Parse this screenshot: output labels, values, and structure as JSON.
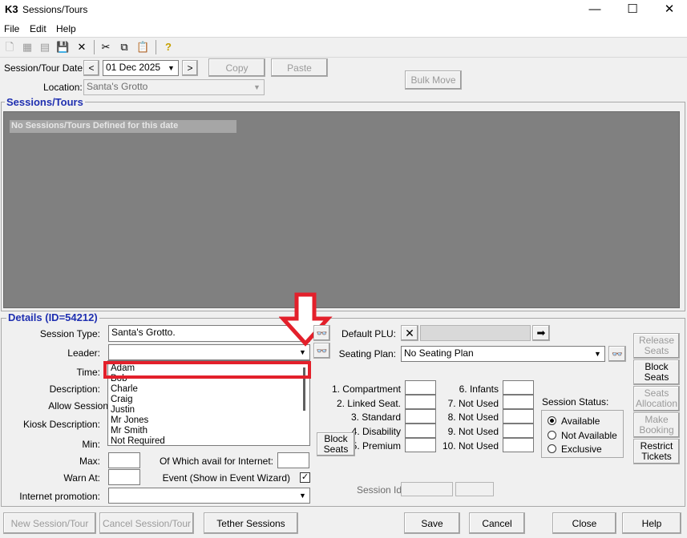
{
  "window": {
    "logo": "K3",
    "title": "Sessions/Tours",
    "minimize": "—",
    "maximize": "☐",
    "close": "✕"
  },
  "menu": {
    "file": "File",
    "edit": "Edit",
    "help": "Help"
  },
  "toolbar": {
    "new": "🗋",
    "grid": "▦",
    "clipboard": "▤",
    "save": "💾",
    "delete": "✕",
    "cut": "✂",
    "copy": "⧉",
    "paste": "📋",
    "help": "?"
  },
  "top": {
    "date_label": "Session/Tour Date:",
    "prev": "<",
    "date_value": "01 Dec 2025",
    "next": ">",
    "copy": "Copy",
    "paste": "Paste",
    "location_label": "Location:",
    "location_value": "Santa's Grotto",
    "bulk_move": "Bulk Move"
  },
  "sessions": {
    "title": "Sessions/Tours",
    "empty_message": "No Sessions/Tours Defined for this date"
  },
  "details": {
    "title": "Details (ID=54212)",
    "session_type_label": "Session Type:",
    "session_type_value": "Santa's Grotto.",
    "leader_label": "Leader:",
    "leader_value": "",
    "time_label": "Time:",
    "description_label": "Description:",
    "allow_session_label": "Allow Session",
    "kiosk_label": "Kiosk Description:",
    "min_label": "Min:",
    "max_label": "Max:",
    "warn_label": "Warn At:",
    "internet_avail_label": "Of Which avail for Internet:",
    "event_label": "Event (Show in Event Wizard)",
    "event_checked": "✓",
    "internet_promo_label": "Internet promotion:",
    "leader_options": [
      "Adam",
      "Bob",
      "Charle",
      "Craig",
      "Justin",
      "Mr Jones",
      "Mr Smith",
      "Not Required"
    ],
    "default_plu_label": "Default PLU:",
    "seating_plan_label": "Seating Plan:",
    "seating_plan_value": "No Seating Plan",
    "block_seats": "Block Seats",
    "seat_types_left": [
      "1. Compartment",
      "2. Linked Seat.",
      "3. Standard",
      "4. Disability",
      "5. Premium"
    ],
    "seat_types_right": [
      "6. Infants",
      "7.   Not Used",
      "8.   Not Used",
      "9.   Not Used",
      "10.  Not Used"
    ],
    "status_label": "Session Status:",
    "status_options": [
      "Available",
      "Not Available",
      "Exclusive"
    ],
    "session_id_label": "Session Id",
    "side_buttons": {
      "release_seats": "Release Seats",
      "block_seats": "Block Seats",
      "seats_allocation": "Seats Allocation",
      "make_booking": "Make Booking",
      "restrict_tickets": "Restrict Tickets"
    }
  },
  "bottom": {
    "new_session": "New Session/Tour",
    "cancel_session": "Cancel Session/Tour",
    "tether": "Tether Sessions",
    "save": "Save",
    "cancel": "Cancel",
    "close": "Close",
    "help": "Help"
  },
  "colors": {
    "highlight": "#e3202b",
    "section_title": "#1f2fb0",
    "panel": "#808080"
  }
}
